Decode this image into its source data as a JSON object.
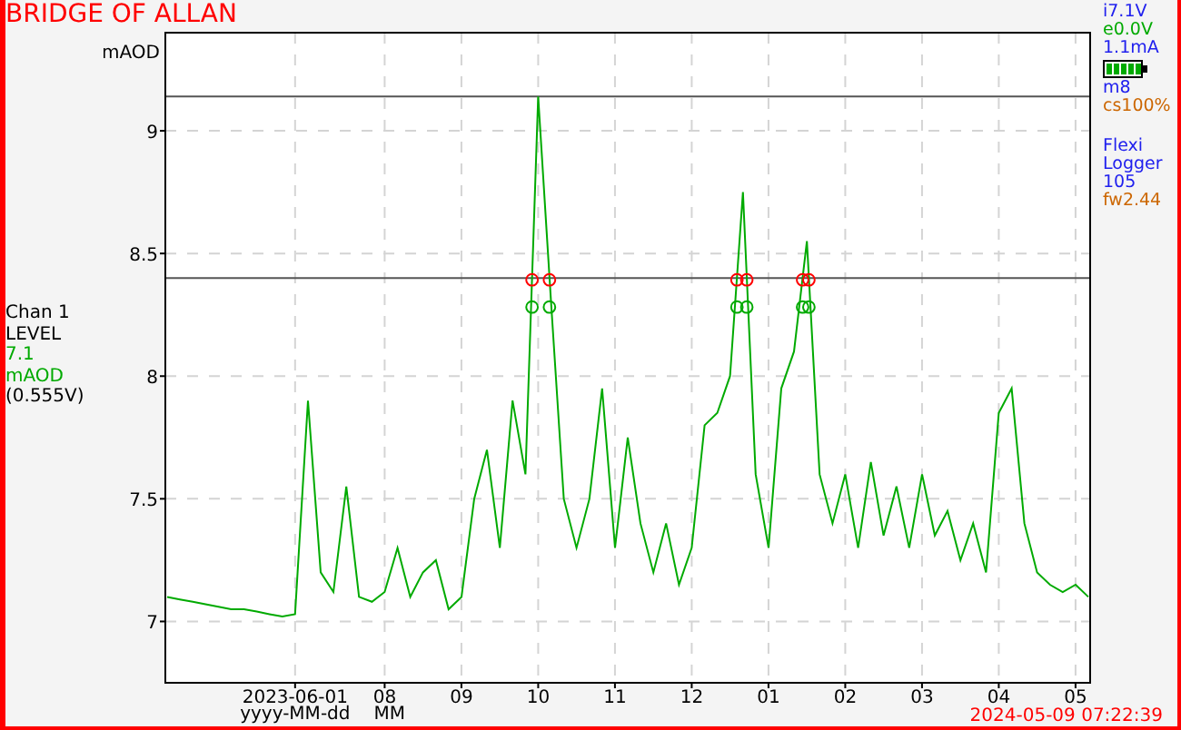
{
  "title": "BRIDGE OF ALLAN",
  "channel": [
    {
      "text": "Chan 1",
      "color": "#000000"
    },
    {
      "text": "LEVEL",
      "color": "#000000"
    },
    {
      "text": "7.1",
      "color": "#00aa00"
    },
    {
      "text": "mAOD",
      "color": "#00aa00"
    },
    {
      "text": "(0.555V)",
      "color": "#000000"
    }
  ],
  "status_panel": {
    "readings": [
      {
        "kind": "text",
        "text": "i7.1V",
        "color": "#2020ee"
      },
      {
        "kind": "text",
        "text": "e0.0V",
        "color": "#00aa00"
      },
      {
        "kind": "text",
        "text": "1.1mA",
        "color": "#2020ee"
      },
      {
        "kind": "battery"
      },
      {
        "kind": "text",
        "text": "m8",
        "color": "#2020ee"
      },
      {
        "kind": "text",
        "text": "cs100%",
        "color": "#cc6600"
      }
    ],
    "device": [
      {
        "text": "Flexi",
        "color": "#2020ee"
      },
      {
        "text": "Logger",
        "color": "#2020ee"
      },
      {
        "text": "105",
        "color": "#2020ee"
      },
      {
        "text": "fw2.44",
        "color": "#cc6600"
      }
    ]
  },
  "chart": {
    "chart_data": {
      "type": "line",
      "ylabel": "mAOD",
      "xlabel": "yyyy-MM-dd",
      "categories": [
        null,
        null,
        null,
        null,
        null,
        null,
        null,
        null,
        null,
        null,
        "2023-06-01",
        null,
        null,
        null,
        null,
        null,
        null,
        "08",
        null,
        null,
        null,
        null,
        null,
        "09",
        null,
        null,
        null,
        null,
        null,
        "10",
        null,
        null,
        null,
        null,
        null,
        "11",
        null,
        null,
        null,
        null,
        null,
        "12",
        null,
        null,
        null,
        null,
        null,
        "01",
        null,
        null,
        null,
        null,
        null,
        "02",
        null,
        null,
        null,
        null,
        null,
        "03",
        null,
        null,
        null,
        null,
        null,
        "04",
        null,
        null,
        null,
        null,
        null,
        "05",
        null
      ],
      "series": [
        {
          "color": "#00aa00",
          "values": [
            7.1,
            7.09,
            7.08,
            7.07,
            7.06,
            7.05,
            7.05,
            7.04,
            7.03,
            7.02,
            7.03,
            7.9,
            7.2,
            7.12,
            7.55,
            7.1,
            7.08,
            7.12,
            7.3,
            7.1,
            7.2,
            7.25,
            7.05,
            7.1,
            7.5,
            7.7,
            7.3,
            7.9,
            7.6,
            9.14,
            8.3,
            7.5,
            7.3,
            7.5,
            7.95,
            7.3,
            7.75,
            7.4,
            7.2,
            7.4,
            7.15,
            7.3,
            7.8,
            7.85,
            8.0,
            8.75,
            7.6,
            7.3,
            7.95,
            8.1,
            8.55,
            7.6,
            7.4,
            7.6,
            7.3,
            7.65,
            7.35,
            7.55,
            7.3,
            7.6,
            7.35,
            7.45,
            7.25,
            7.4,
            7.2,
            7.85,
            7.95,
            7.4,
            7.2,
            7.15,
            7.12,
            7.15,
            7.1
          ]
        }
      ],
      "ylim": [
        6.75,
        9.4
      ],
      "yticks": [
        7,
        7.5,
        8,
        8.5,
        9
      ],
      "grid": true,
      "ref_lines": [
        {
          "axis": "y",
          "value": 9.14
        },
        {
          "axis": "y",
          "value": 8.4
        }
      ]
    },
    "x_unit_label": "MM"
  },
  "timestamp": "2024-05-09 07:22:39"
}
